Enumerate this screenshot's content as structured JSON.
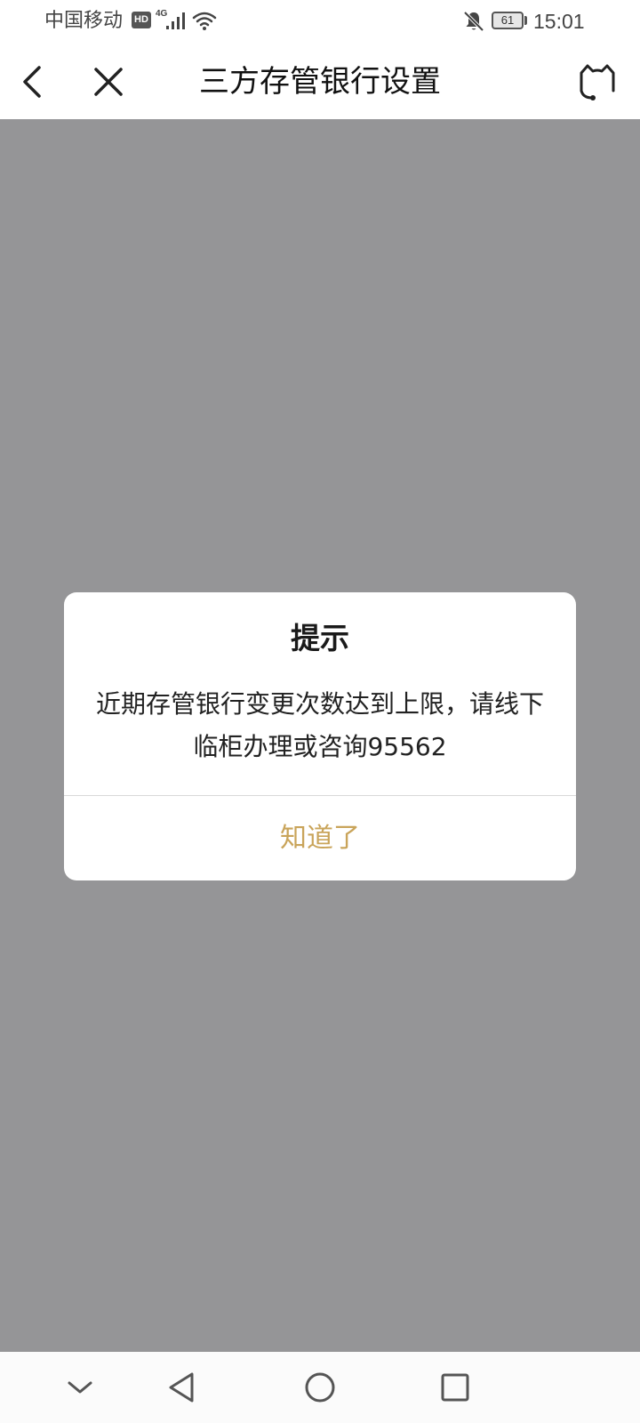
{
  "status_bar": {
    "carrier": "中国移动",
    "hd_badge": "HD",
    "network_type": "4G",
    "battery_level": "61",
    "time": "15:01",
    "icons": [
      "hd-icon",
      "signal-icon",
      "wifi-icon",
      "mute-bell-icon",
      "battery-icon"
    ]
  },
  "header": {
    "title": "三方存管银行设置",
    "back_icon": "chevron-left-icon",
    "close_icon": "close-icon",
    "service_icon": "customer-service-icon"
  },
  "dialog": {
    "title": "提示",
    "message": "近期存管银行变更次数达到上限，请线下临柜办理或咨询95562",
    "confirm_label": "知道了",
    "confirm_color": "#c9a45a"
  },
  "nav_bar": {
    "icons": [
      "chevron-down-icon",
      "triangle-back-icon",
      "circle-home-icon",
      "square-recent-icon"
    ]
  },
  "colors": {
    "mask": "#959597",
    "accent": "#c9a45a",
    "background": "#ffffff"
  }
}
